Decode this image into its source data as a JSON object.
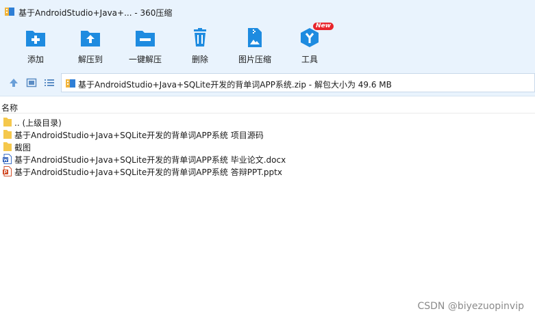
{
  "window": {
    "title": "基于AndroidStudio+Java+... - 360压缩"
  },
  "toolbar": {
    "items": [
      {
        "label": "添加",
        "icon": "add-icon"
      },
      {
        "label": "解压到",
        "icon": "extract-to-icon"
      },
      {
        "label": "一键解压",
        "icon": "one-click-extract-icon"
      },
      {
        "label": "删除",
        "icon": "delete-icon"
      },
      {
        "label": "图片压缩",
        "icon": "image-compress-icon"
      },
      {
        "label": "工具",
        "icon": "tools-icon",
        "badge": "New"
      }
    ]
  },
  "nav": {
    "buttons": [
      "up-icon",
      "view-thumbnail-icon",
      "view-list-icon"
    ],
    "path": "基于AndroidStudio+Java+SQLite开发的背单词APP系统.zip - 解包大小为 49.6 MB"
  },
  "file_list": {
    "column_header": "名称",
    "rows": [
      {
        "name": ".. (上级目录)",
        "type": "folder"
      },
      {
        "name": "基于AndroidStudio+Java+SQLite开发的背单词APP系统 项目源码",
        "type": "folder"
      },
      {
        "name": "截图",
        "type": "folder"
      },
      {
        "name": "基于AndroidStudio+Java+SQLite开发的背单词APP系统 毕业论文.docx",
        "type": "docx"
      },
      {
        "name": "基于AndroidStudio+Java+SQLite开发的背单词APP系统 答辩PPT.pptx",
        "type": "pptx"
      }
    ]
  },
  "watermark": "CSDN @biyezuopinvip",
  "colors": {
    "accent": "#1e8be0",
    "background": "#e9f3fd",
    "folder": "#f5c84c",
    "badge": "#e8252b"
  }
}
